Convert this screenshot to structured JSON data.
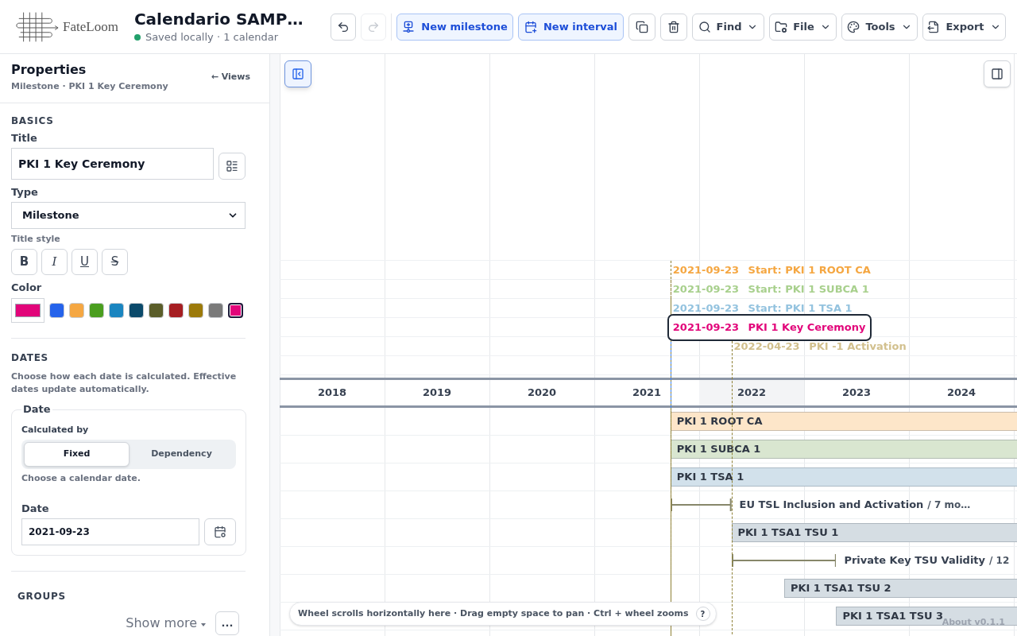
{
  "header": {
    "logo": {
      "wordmark": "FateLoom"
    },
    "title": "Calendario SAMP…",
    "status": "Saved locally · 1 calendar"
  },
  "toolbar": {
    "history": [
      {
        "disabled": false
      },
      {
        "disabled": true
      }
    ],
    "create": [
      {
        "label": "New milestone"
      },
      {
        "label": "New interval"
      }
    ],
    "edit": [
      {
        "disabled": false
      },
      {
        "disabled": false
      }
    ],
    "menus": [
      {
        "label": "Find"
      },
      {
        "label": "File"
      },
      {
        "label": "Tools"
      },
      {
        "label": "Export"
      }
    ]
  },
  "sidebar": {
    "header": {
      "title": "Properties",
      "subtitle": "Milestone · PKI 1 Key Ceremony",
      "views_link": "← Views"
    },
    "basics": {
      "heading": "BASICS",
      "title_field": {
        "label": "Title",
        "value": "PKI 1 Key Ceremony"
      },
      "type_field": {
        "label": "Type",
        "value": "Milestone"
      },
      "title_style": {
        "label": "Title style",
        "buttons": [
          {
            "label": "B",
            "active": false
          },
          {
            "label": "I",
            "active": false
          },
          {
            "label": "U",
            "active": false
          },
          {
            "label": "S",
            "active": false
          }
        ]
      },
      "color": {
        "label": "Color",
        "swatches": [
          {
            "color": "#2563eb",
            "selected": false
          },
          {
            "color": "#f5a742",
            "selected": false
          },
          {
            "color": "#4a9e1f",
            "selected": false
          },
          {
            "color": "#1a85c0",
            "selected": false
          },
          {
            "color": "#0b4a6b",
            "selected": false
          },
          {
            "color": "#5b5e2a",
            "selected": false
          },
          {
            "color": "#a61e22",
            "selected": false
          },
          {
            "color": "#9c7a0a",
            "selected": false
          },
          {
            "color": "#7a7a7a",
            "selected": false
          },
          {
            "color": "#e2057a",
            "selected": true
          }
        ]
      }
    },
    "dates": {
      "heading": "DATES",
      "description": "Choose how each date is calculated. Effective dates update automatically.",
      "date_group": {
        "legend": "Date",
        "calculated_by": {
          "label": "Calculated by",
          "options": [
            {
              "label": "Fixed",
              "selected": true
            },
            {
              "label": "Dependency",
              "selected": false
            }
          ]
        },
        "hint": "Choose a calendar date.",
        "date_field": {
          "label": "Date",
          "value": "2021-09-23"
        }
      }
    },
    "groups": {
      "heading": "GROUPS",
      "show_more": "Show more",
      "more_button": "..."
    }
  },
  "timeline": {
    "years": [
      {
        "label": "2018",
        "highlighted": false
      },
      {
        "label": "2019",
        "highlighted": false
      },
      {
        "label": "2020",
        "highlighted": false
      },
      {
        "label": "2021",
        "highlighted": false
      },
      {
        "label": "2022",
        "highlighted": true
      },
      {
        "label": "2023",
        "highlighted": false
      },
      {
        "label": "2024",
        "highlighted": false
      }
    ],
    "milestones": [
      {
        "date": "2021-09-23",
        "title": "Start: PKI 1 ROOT CA",
        "color": "#f5a742",
        "selected": false
      },
      {
        "date": "2021-09-23",
        "title": "Start: PKI 1 SUBCA 1",
        "color": "#a8d08d",
        "selected": false
      },
      {
        "date": "2021-09-23",
        "title": "Start: PKI 1 TSA 1",
        "color": "#94c3df",
        "selected": false
      },
      {
        "date": "2021-09-23",
        "title": "PKI 1 Key Ceremony",
        "color": "#e2057a",
        "selected": true
      },
      {
        "date": "2022-04-23",
        "title": "PKI -1 Activation",
        "color": "#d2c08e",
        "selected": false
      }
    ],
    "rows": [
      {
        "kind": "bar",
        "title": "PKI 1 ROOT CA",
        "color": "#fde6c9"
      },
      {
        "kind": "bar",
        "title": "PKI 1 SUBCA 1",
        "color": "#d9e6d0"
      },
      {
        "kind": "bar",
        "title": "PKI 1 TSA 1",
        "color": "#d2e1eb"
      },
      {
        "kind": "interval",
        "title": "EU TSL Inclusion and Activation",
        "duration": "/ 7 mo…"
      },
      {
        "kind": "bar",
        "title": "PKI 1 TSA1 TSU 1",
        "color": "#d5dde3"
      },
      {
        "kind": "interval",
        "title": "Private Key TSU Validity",
        "duration": "/ 12"
      },
      {
        "kind": "bar",
        "title": "PKI 1 TSA1 TSU 2",
        "color": "#d5dde3"
      },
      {
        "kind": "bar",
        "title": "PKI 1 TSA1 TSU 3",
        "color": "#d5dde3"
      }
    ],
    "hint": {
      "text": "Wheel scrolls horizontally here · Drag empty space to pan · Ctrl + wheel zooms",
      "help": "?"
    },
    "about": "About v0.1.1"
  }
}
